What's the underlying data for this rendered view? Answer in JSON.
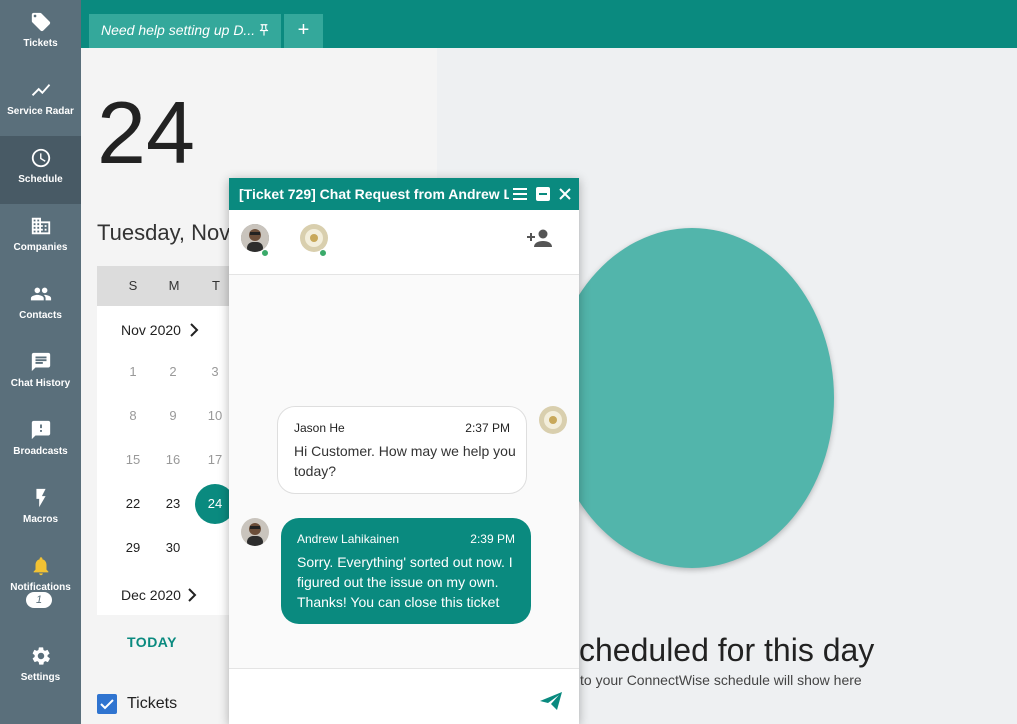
{
  "sidebar": {
    "items": [
      {
        "label": "Tickets",
        "icon": "tag-icon"
      },
      {
        "label": "Service Radar",
        "icon": "trend-icon"
      },
      {
        "label": "Schedule",
        "icon": "clock-icon"
      },
      {
        "label": "Companies",
        "icon": "building-icon"
      },
      {
        "label": "Contacts",
        "icon": "people-icon"
      },
      {
        "label": "Chat History",
        "icon": "chat-icon"
      },
      {
        "label": "Broadcasts",
        "icon": "broadcast-icon"
      },
      {
        "label": "Macros",
        "icon": "bolt-icon"
      },
      {
        "label": "Notifications",
        "icon": "bell-icon"
      },
      {
        "label": "Settings",
        "icon": "gear-icon"
      }
    ],
    "active": "Schedule",
    "notification_count": "1"
  },
  "tabs": {
    "current_tab": "Need help setting up D...",
    "add_label": "+"
  },
  "schedule": {
    "day_number": "24",
    "full_date": "Tuesday, Nov",
    "weekday_headers": [
      "S",
      "M",
      "T"
    ],
    "month_nov": "Nov 2020",
    "month_dec": "Dec 2020",
    "days": [
      "1",
      "2",
      "3",
      "8",
      "9",
      "10",
      "15",
      "16",
      "17",
      "22",
      "23",
      "24",
      "29",
      "30"
    ],
    "selected_day": "24",
    "today_label": "TODAY",
    "tickets_label": "Tickets",
    "empty_title": "scheduled for this day",
    "empty_subtitle": "to your ConnectWise schedule will show here"
  },
  "chat": {
    "title": "[Ticket 729] Chat Request from Andrew L...",
    "messages": [
      {
        "sender": "Jason He",
        "time": "2:37 PM",
        "text": "Hi Customer. How may we help you today?"
      },
      {
        "sender": "Andrew Lahikainen",
        "time": "2:39 PM",
        "text": "Sorry. Everything' sorted out now. I figured out the issue on my own. Thanks! You can close this ticket"
      }
    ]
  },
  "colors": {
    "sidebar": "#5a6f7b",
    "accent": "#0a8a7f",
    "circle": "#52b5ab"
  }
}
